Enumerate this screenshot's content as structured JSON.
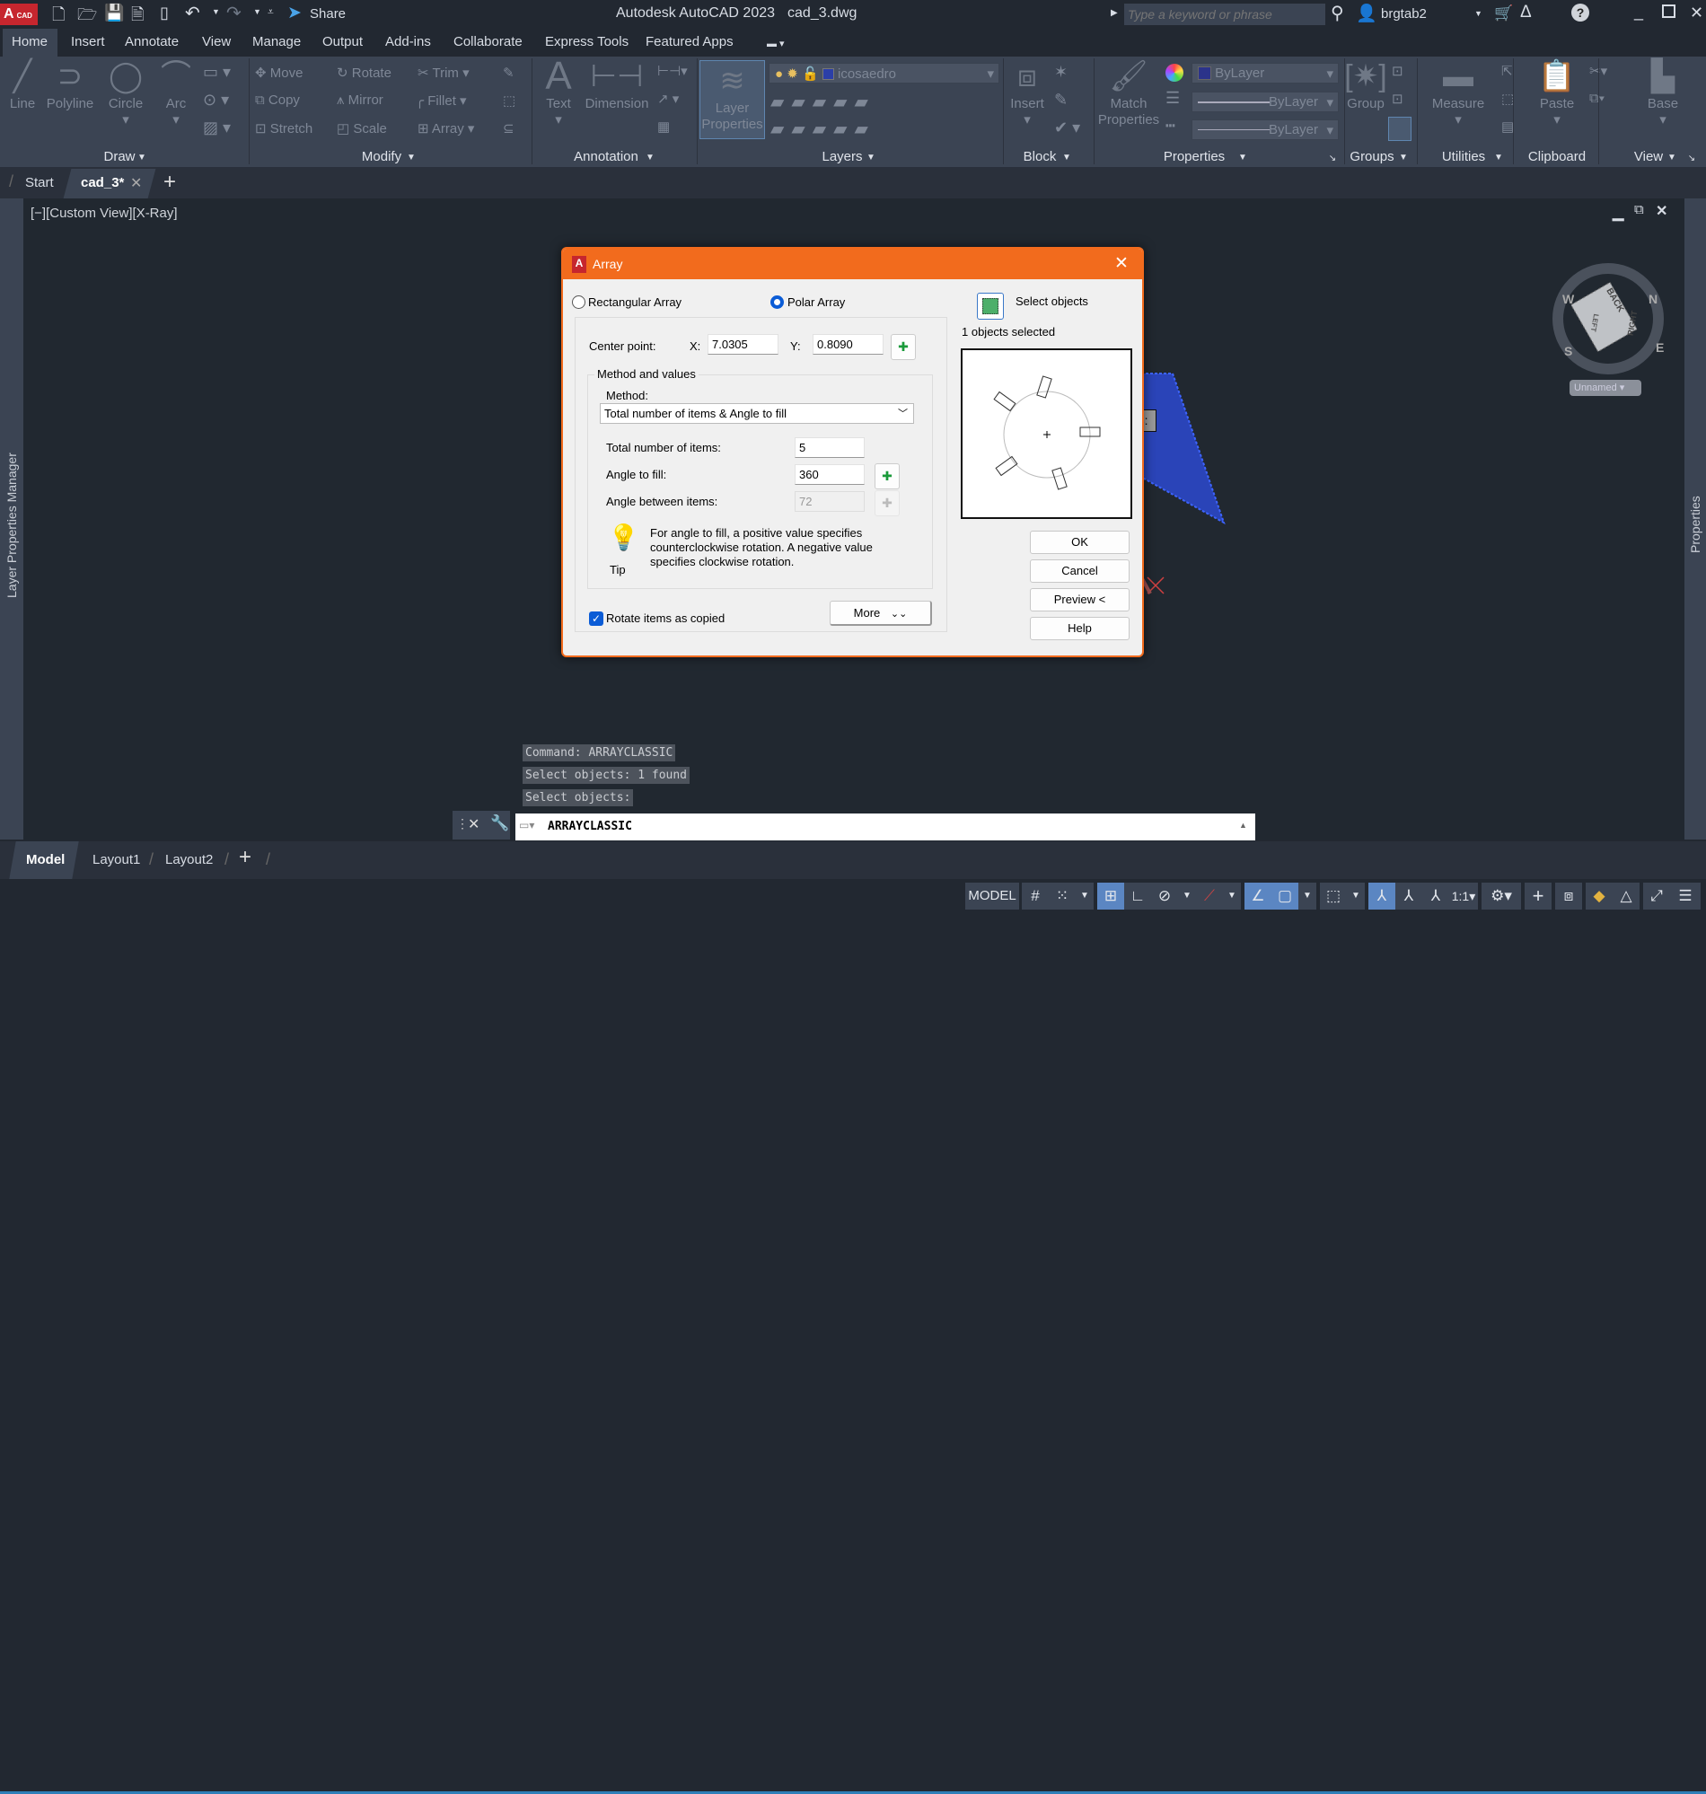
{
  "app": {
    "title": "Autodesk AutoCAD 2023",
    "file": "cad_3.dwg",
    "logo_text": "CAD",
    "share_label": "Share",
    "search_placeholder": "Type a keyword or phrase",
    "user": "brgtab2",
    "accent": "#f26b1d"
  },
  "ribbon_tabs": [
    "Home",
    "Insert",
    "Annotate",
    "View",
    "Manage",
    "Output",
    "Add-ins",
    "Collaborate",
    "Express Tools",
    "Featured Apps"
  ],
  "ribbon": {
    "draw": {
      "label": "Draw",
      "tools": [
        "Line",
        "Polyline",
        "Circle",
        "Arc"
      ]
    },
    "modify": {
      "label": "Modify",
      "tools": [
        "Move",
        "Rotate",
        "Trim",
        "Copy",
        "Mirror",
        "Fillet",
        "Stretch",
        "Scale",
        "Array"
      ]
    },
    "annotation": {
      "label": "Annotation",
      "tools": [
        "Text",
        "Dimension"
      ]
    },
    "layers": {
      "label": "Layers",
      "layer_properties": "Layer Properties",
      "current_layer": "icosaedro"
    },
    "block": {
      "label": "Block",
      "insert": "Insert"
    },
    "properties": {
      "label": "Properties",
      "match": "Match Properties",
      "color": "ByLayer",
      "lineweight": "ByLayer",
      "linetype": "ByLayer"
    },
    "groups": {
      "label": "Groups",
      "group": "Group"
    },
    "utilities": {
      "label": "Utilities",
      "measure": "Measure"
    },
    "clipboard": {
      "label": "Clipboard",
      "paste": "Paste"
    },
    "view": {
      "label": "View",
      "base": "Base"
    }
  },
  "doc_tabs": {
    "start": "Start",
    "active": "cad_3*"
  },
  "viewport": {
    "label": "[−][Custom View][X-Ray]",
    "left_palette": "Layer Properties Manager",
    "right_palette": "Properties",
    "viewcube": {
      "top": "BACK",
      "right": "RIGHT",
      "front": "LEFT",
      "compass": [
        "W",
        "N",
        "E",
        "S"
      ],
      "ucs": "Unnamed"
    },
    "tooltip_fragment": "ects:"
  },
  "dialog": {
    "title": "Array",
    "radio_rect": "Rectangular Array",
    "radio_polar": "Polar Array",
    "selected_mode": "polar",
    "select_objects": "Select objects",
    "objects_selected": "1 objects selected",
    "center_point_label": "Center point:",
    "x_label": "X:",
    "x_value": "7.0305",
    "y_label": "Y:",
    "y_value": "0.8090",
    "method_group": "Method and values",
    "method_label": "Method:",
    "method_value": "Total number of items & Angle to fill",
    "total_items_label": "Total number of items:",
    "total_items": "5",
    "angle_fill_label": "Angle to fill:",
    "angle_fill": "360",
    "angle_between_label": "Angle between items:",
    "angle_between": "72",
    "tip_label": "Tip",
    "tip_text": [
      "For angle to fill, a positive value specifies",
      "counterclockwise rotation.  A negative value",
      "specifies clockwise rotation."
    ],
    "rotate_label": "Rotate items as copied",
    "rotate_checked": true,
    "more": "More",
    "ok": "OK",
    "cancel": "Cancel",
    "preview": "Preview <",
    "help": "Help"
  },
  "command": {
    "history": [
      "Command: ARRAYCLASSIC",
      "Select objects: 1 found",
      "Select objects:"
    ],
    "input": "ARRAYCLASSIC"
  },
  "layout_tabs": [
    "Model",
    "Layout1",
    "Layout2"
  ],
  "status": {
    "model": "MODEL",
    "scale": "1:1"
  }
}
